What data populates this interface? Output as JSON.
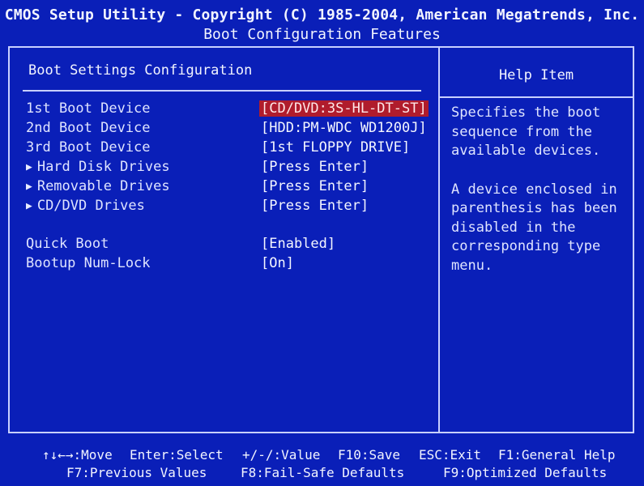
{
  "header": {
    "line1": "CMOS Setup Utility - Copyright (C) 1985-2004, American Megatrends, Inc.",
    "line2": "Boot Configuration Features"
  },
  "main": {
    "section_title": "Boot Settings Configuration",
    "items": [
      {
        "label": "1st Boot Device",
        "value": "[CD/DVD:3S-HL-DT-ST]",
        "submenu": false,
        "selected": true
      },
      {
        "label": "2nd Boot Device",
        "value": "[HDD:PM-WDC WD1200J]",
        "submenu": false,
        "selected": false
      },
      {
        "label": "3rd Boot Device",
        "value": "[1st FLOPPY DRIVE]",
        "submenu": false,
        "selected": false
      },
      {
        "label": "Hard Disk Drives",
        "value": "[Press Enter]",
        "submenu": true,
        "selected": false
      },
      {
        "label": "Removable Drives",
        "value": "[Press Enter]",
        "submenu": true,
        "selected": false
      },
      {
        "label": "CD/DVD Drives",
        "value": "[Press Enter]",
        "submenu": true,
        "selected": false
      },
      {
        "label": "Quick Boot",
        "value": "[Enabled]",
        "submenu": false,
        "selected": false
      },
      {
        "label": "Bootup Num-Lock",
        "value": "[On]",
        "submenu": false,
        "selected": false
      }
    ]
  },
  "help": {
    "title": "Help Item",
    "paragraphs": [
      "Specifies the boot sequence from the available devices.",
      "A device enclosed in parenthesis has been disabled in the corresponding type menu."
    ]
  },
  "footer": {
    "move": "↑↓←→:Move",
    "enter": "Enter:Select",
    "value": "+/-/:Value",
    "f10": "F10:Save",
    "esc": "ESC:Exit",
    "f1": "F1:General Help",
    "f7": "F7:Previous Values",
    "f8": "F8:Fail-Safe Defaults",
    "f9": "F9:Optimized Defaults"
  },
  "colors": {
    "background": "#0a1fb8",
    "text": "#e8ecff",
    "selected_background": "#b01c2c",
    "border": "#c8d0ff"
  },
  "icons": {
    "submenu": "right-triangle-icon"
  }
}
